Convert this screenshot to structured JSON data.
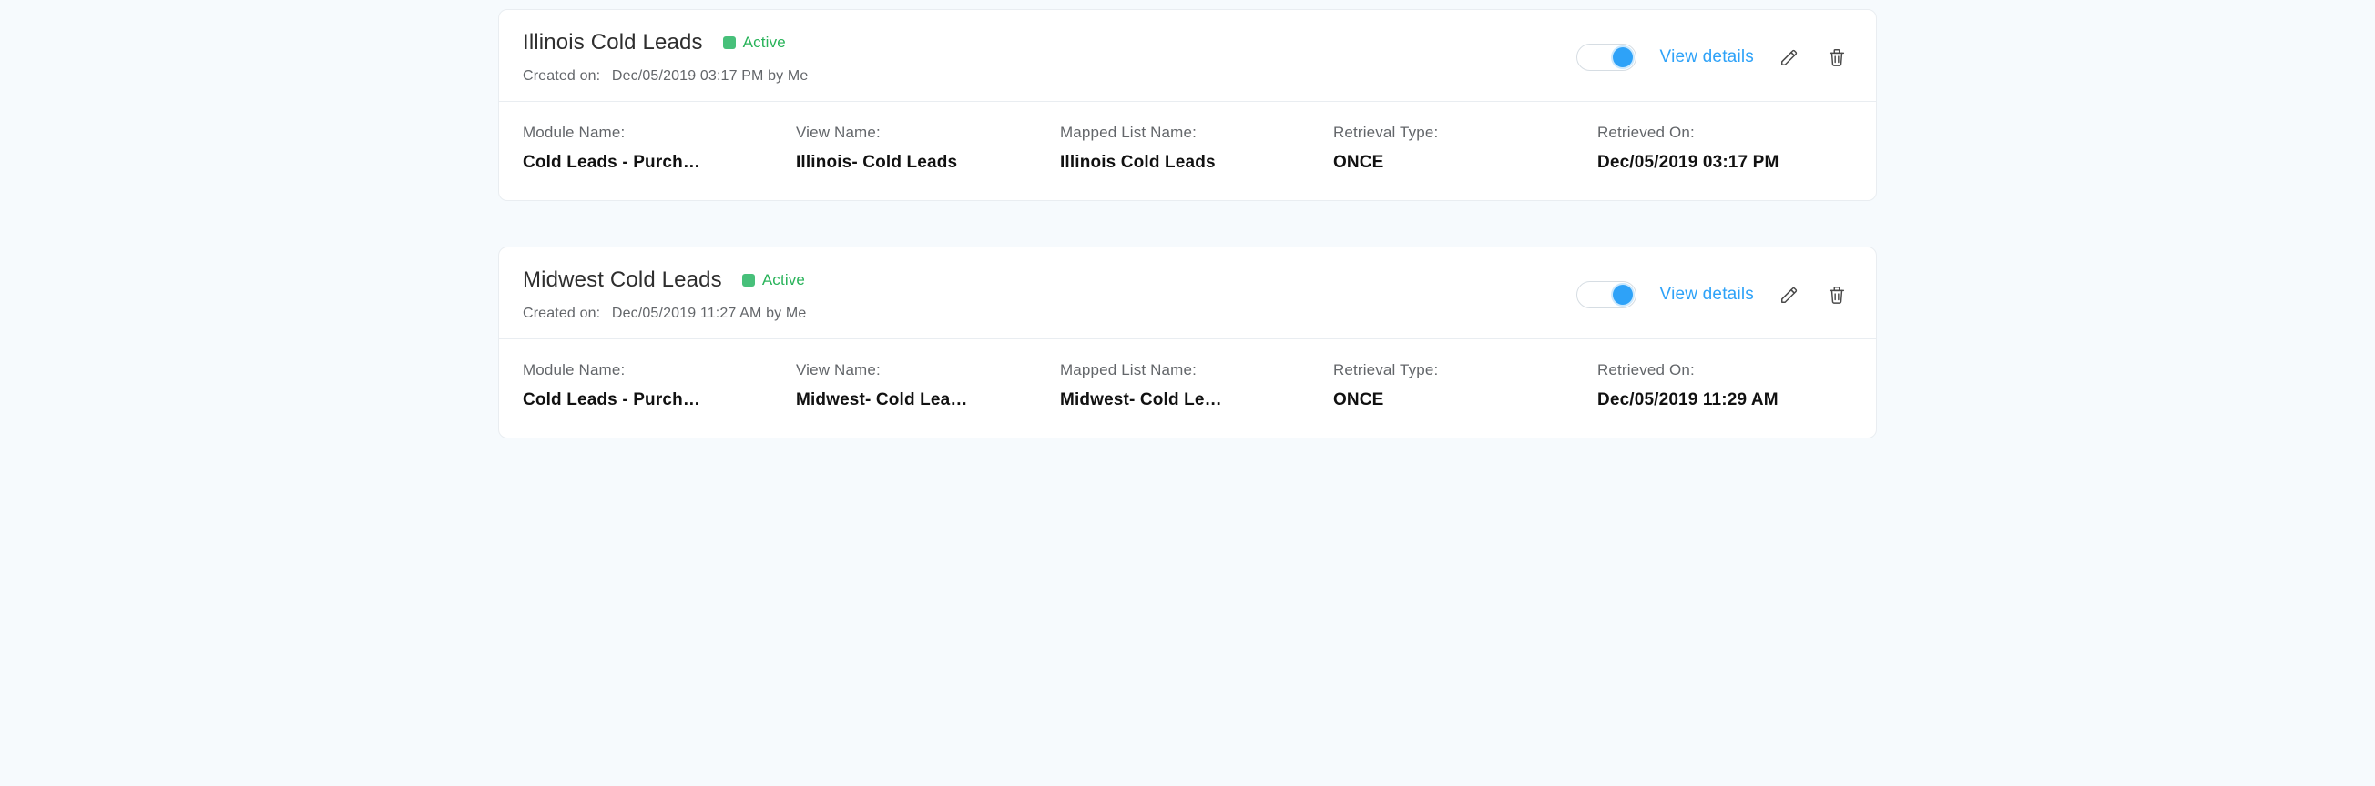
{
  "labels": {
    "created_on": "Created on:",
    "view_details": "View details",
    "module_name": "Module Name:",
    "view_name": "View Name:",
    "mapped_list_name": "Mapped List Name:",
    "retrieval_type": "Retrieval Type:",
    "retrieved_on": "Retrieved On:"
  },
  "cards": [
    {
      "title": "Illinois Cold Leads",
      "status": "Active",
      "created": "Dec/05/2019 03:17 PM by Me",
      "toggled": true,
      "module_name": "Cold Leads - Purch…",
      "view_name": "Illinois- Cold Leads",
      "mapped_list_name": "Illinois Cold Leads",
      "retrieval_type": "ONCE",
      "retrieved_on": "Dec/05/2019 03:17 PM"
    },
    {
      "title": "Midwest Cold Leads",
      "status": "Active",
      "created": "Dec/05/2019 11:27 AM by Me",
      "toggled": true,
      "module_name": "Cold Leads - Purch…",
      "view_name": "Midwest- Cold Lea…",
      "mapped_list_name": "Midwest- Cold Le…",
      "retrieval_type": "ONCE",
      "retrieved_on": "Dec/05/2019 11:29 AM"
    }
  ]
}
